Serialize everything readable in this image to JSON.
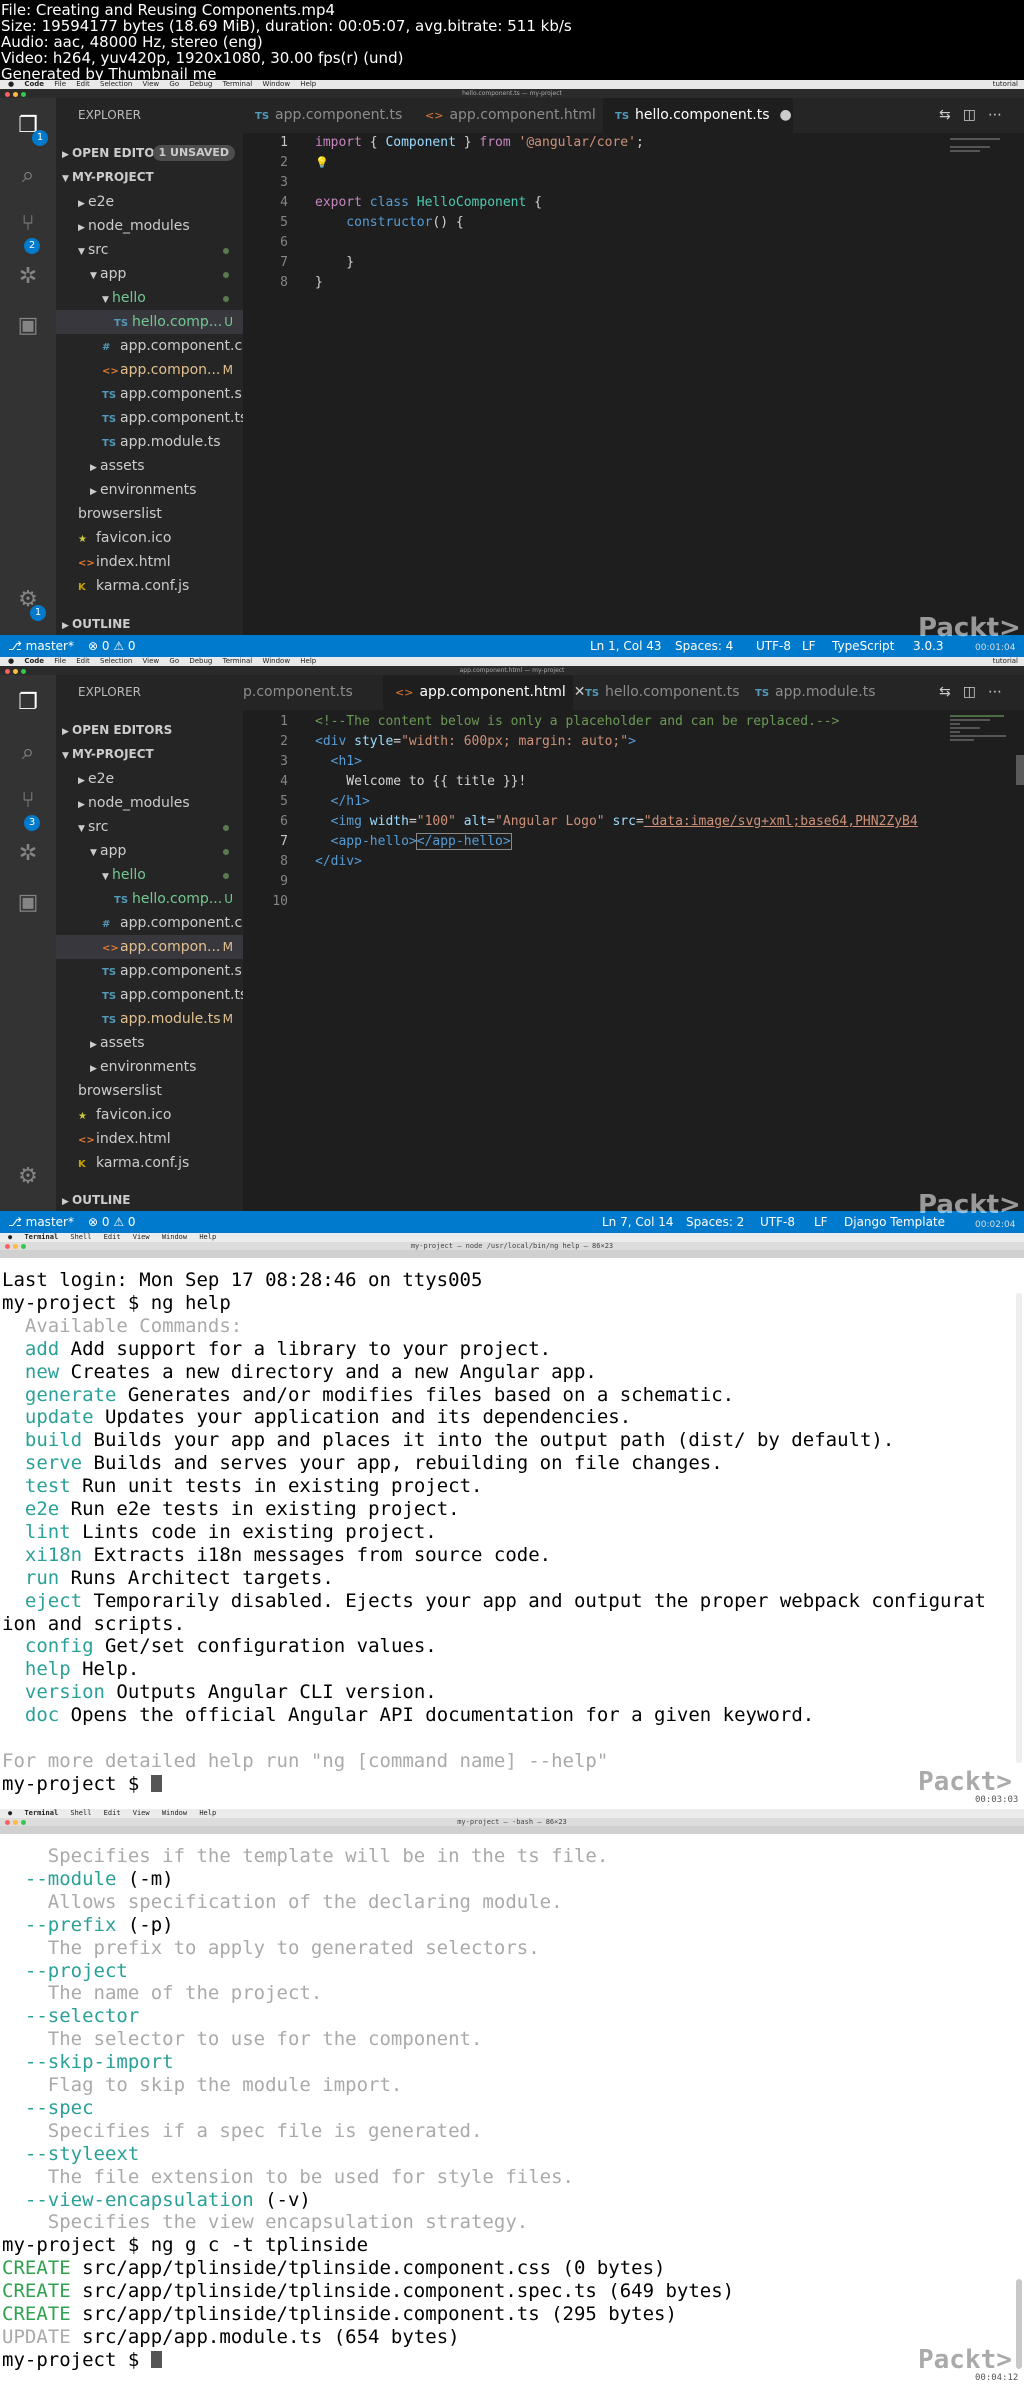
{
  "video_info": {
    "lines": [
      "File: Creating and Reusing Components.mp4",
      "Size: 19594177 bytes (18.69 MiB), duration: 00:05:07, avg.bitrate: 511 kb/s",
      "Audio: aac, 48000 Hz, stereo (eng)",
      "Video: h264, yuv420p, 1920x1080, 30.00 fps(r) (und)",
      "Generated by Thumbnail me"
    ]
  },
  "watermark": "Packt>",
  "frame1": {
    "menu": [
      "Code",
      "File",
      "Edit",
      "Selection",
      "View",
      "Go",
      "Debug",
      "Terminal",
      "Window",
      "Help"
    ],
    "menu_right": "tutorial",
    "window_title": "hello.component.ts — my-project",
    "explorer_title": "EXPLORER",
    "open_editors": "OPEN EDITORS",
    "unsaved": "1 UNSAVED",
    "project": "MY-PROJECT",
    "outline": "OUTLINE",
    "tree": [
      {
        "label": "e2e",
        "icon": "",
        "mark": ""
      },
      {
        "label": "node_modules",
        "icon": "",
        "mark": ""
      },
      {
        "label": "src",
        "icon": "",
        "mark": "dot"
      },
      {
        "label": "app",
        "icon": "",
        "mark": "dot"
      },
      {
        "label": "hello",
        "icon": "",
        "mark": "dot"
      },
      {
        "label": "hello.comp...",
        "icon": "TS",
        "mark": "U"
      },
      {
        "label": "app.component.css",
        "icon": "#",
        "mark": ""
      },
      {
        "label": "app.compon...",
        "icon": "<>",
        "mark": "M"
      },
      {
        "label": "app.component.s...",
        "icon": "TS",
        "mark": ""
      },
      {
        "label": "app.component.ts",
        "icon": "TS",
        "mark": ""
      },
      {
        "label": "app.module.ts",
        "icon": "TS",
        "mark": ""
      },
      {
        "label": "assets",
        "icon": "",
        "mark": ""
      },
      {
        "label": "environments",
        "icon": "",
        "mark": ""
      },
      {
        "label": "browserslist",
        "icon": "",
        "mark": ""
      },
      {
        "label": "favicon.ico",
        "icon": "★",
        "mark": ""
      },
      {
        "label": "index.html",
        "icon": "<>",
        "mark": ""
      },
      {
        "label": "karma.conf.js",
        "icon": "K",
        "mark": ""
      }
    ],
    "tabs": [
      "app.component.ts",
      "app.component.html",
      "hello.component.ts"
    ],
    "line_numbers": [
      "1",
      "2",
      "3",
      "4",
      "5",
      "6",
      "7",
      "8"
    ],
    "code": {
      "l1a": "import",
      "l1b": " { ",
      "l1c": "Component",
      "l1d": " } ",
      "l1e": "from",
      "l1f": " '@angular/core'",
      "l1g": ";",
      "l2": "💡",
      "l4a": "export",
      "l4b": " class ",
      "l4c": "HelloComponent",
      "l4d": " {",
      "l5a": "    constructor",
      "l5b": "() {",
      "l7": "    }",
      "l8": "}"
    },
    "status": {
      "branch": "⎇ master*",
      "problems": "⊗ 0 ⚠ 0",
      "position": "Ln 1, Col 43",
      "spaces": "Spaces: 4",
      "encoding": "UTF-8",
      "eol": "LF",
      "language": "TypeScript",
      "version": "3.0.3"
    },
    "timecode": "00:01:04"
  },
  "frame2": {
    "window_title": "app.component.html — my-project",
    "explorer_title": "EXPLORER",
    "open_editors": "OPEN EDITORS",
    "project": "MY-PROJECT",
    "outline": "OUTLINE",
    "tree": [
      {
        "label": "e2e",
        "icon": "",
        "mark": ""
      },
      {
        "label": "node_modules",
        "icon": "",
        "mark": ""
      },
      {
        "label": "src",
        "icon": "",
        "mark": "dot"
      },
      {
        "label": "app",
        "icon": "",
        "mark": "dot"
      },
      {
        "label": "hello",
        "icon": "",
        "mark": "dot"
      },
      {
        "label": "hello.comp...",
        "icon": "TS",
        "mark": "U"
      },
      {
        "label": "app.component.css",
        "icon": "#",
        "mark": ""
      },
      {
        "label": "app.compon...",
        "icon": "<>",
        "mark": "M"
      },
      {
        "label": "app.component.s...",
        "icon": "TS",
        "mark": ""
      },
      {
        "label": "app.component.ts",
        "icon": "TS",
        "mark": ""
      },
      {
        "label": "app.module.ts",
        "icon": "TS",
        "mark": "M"
      },
      {
        "label": "assets",
        "icon": "",
        "mark": ""
      },
      {
        "label": "environments",
        "icon": "",
        "mark": ""
      },
      {
        "label": "browserslist",
        "icon": "",
        "mark": ""
      },
      {
        "label": "favicon.ico",
        "icon": "★",
        "mark": ""
      },
      {
        "label": "index.html",
        "icon": "<>",
        "mark": ""
      },
      {
        "label": "karma.conf.js",
        "icon": "K",
        "mark": ""
      }
    ],
    "tabs": [
      "p.component.ts",
      "app.component.html",
      "hello.component.ts",
      "app.module.ts"
    ],
    "line_numbers": [
      "1",
      "2",
      "3",
      "4",
      "5",
      "6",
      "7",
      "8",
      "9",
      "10"
    ],
    "code": {
      "l1": "<!--The content below is only a placeholder and can be replaced.-->",
      "l2a": "<div ",
      "l2b": "style",
      "l2c": "=",
      "l2d": "\"width: 600px; margin: auto;\"",
      "l2e": ">",
      "l3": "  <h1>",
      "l4": "    Welcome to {{ title }}!",
      "l5": "  </h1>",
      "l6a": "  <img ",
      "l6b": "width",
      "l6c": "=",
      "l6d": "\"100\"",
      "l6e": " alt",
      "l6f": "=",
      "l6g": "\"Angular Logo\"",
      "l6h": " src",
      "l6i": "=",
      "l6j": "\"data:image/svg+xml;base64,PHN2ZyB4",
      "l7a": "  <app-hello>",
      "l7b": "</app-hello>",
      "l8": "</div>"
    },
    "status": {
      "branch": "⎇ master*",
      "problems": "⊗ 0 ⚠ 0",
      "position": "Ln 7, Col 14",
      "spaces": "Spaces: 2",
      "encoding": "UTF-8",
      "eol": "LF",
      "language": "Django Template"
    },
    "timecode": "00:02:04"
  },
  "frame3": {
    "menu": [
      "Terminal",
      "Shell",
      "Edit",
      "View",
      "Window",
      "Help"
    ],
    "title": "my-project — node /usr/local/bin/ng help — 86×23",
    "lines": [
      {
        "cmd": "",
        "text": "Last login: Mon Sep 17 08:28:46 on ttys005"
      },
      {
        "cmd": "",
        "text": "my-project $ ng help"
      },
      {
        "cmd": "",
        "text": "Available Commands:",
        "dim": true
      },
      {
        "cmd": "add",
        "text": " Add support for a library to your project."
      },
      {
        "cmd": "new",
        "text": " Creates a new directory and a new Angular app."
      },
      {
        "cmd": "generate",
        "text": " Generates and/or modifies files based on a schematic."
      },
      {
        "cmd": "update",
        "text": " Updates your application and its dependencies."
      },
      {
        "cmd": "build",
        "text": " Builds your app and places it into the output path (dist/ by default)."
      },
      {
        "cmd": "serve",
        "text": " Builds and serves your app, rebuilding on file changes."
      },
      {
        "cmd": "test",
        "text": " Run unit tests in existing project."
      },
      {
        "cmd": "e2e",
        "text": " Run e2e tests in existing project."
      },
      {
        "cmd": "lint",
        "text": " Lints code in existing project."
      },
      {
        "cmd": "xi18n",
        "text": " Extracts i18n messages from source code."
      },
      {
        "cmd": "run",
        "text": " Runs Architect targets."
      },
      {
        "cmd": "eject",
        "text": " Temporarily disabled. Ejects your app and output the proper webpack configurat"
      },
      {
        "cmd": "",
        "text": "ion and scripts.",
        "noindent": true
      },
      {
        "cmd": "config",
        "text": " Get/set configuration values."
      },
      {
        "cmd": "help",
        "text": " Help."
      },
      {
        "cmd": "version",
        "text": " Outputs Angular CLI version."
      },
      {
        "cmd": "doc",
        "text": " Opens the official Angular API documentation for a given keyword."
      },
      {
        "cmd": "",
        "text": ""
      },
      {
        "cmd": "",
        "text": "For more detailed help run \"ng [command name] --help\"",
        "dim": true
      },
      {
        "cmd": "",
        "text": "my-project $ ",
        "cursor": true
      }
    ],
    "timecode": "00:03:03"
  },
  "frame4": {
    "title": "my-project — -bash — 86×23",
    "lines": [
      {
        "kind": "dim",
        "text": "  Specifies if the template will be in the ts file."
      },
      {
        "kind": "opt",
        "opt": "--module",
        "text": " (-m)"
      },
      {
        "kind": "dim",
        "text": "  Allows specification of the declaring module."
      },
      {
        "kind": "opt",
        "opt": "--prefix",
        "text": " (-p)"
      },
      {
        "kind": "dim",
        "text": "  The prefix to apply to generated selectors."
      },
      {
        "kind": "opt",
        "opt": "--project",
        "text": ""
      },
      {
        "kind": "dim",
        "text": "  The name of the project."
      },
      {
        "kind": "opt",
        "opt": "--selector",
        "text": ""
      },
      {
        "kind": "dim",
        "text": "  The selector to use for the component."
      },
      {
        "kind": "opt",
        "opt": "--skip-import",
        "text": ""
      },
      {
        "kind": "dim",
        "text": "  Flag to skip the module import."
      },
      {
        "kind": "opt",
        "opt": "--spec",
        "text": ""
      },
      {
        "kind": "dim",
        "text": "  Specifies if a spec file is generated."
      },
      {
        "kind": "opt",
        "opt": "--styleext",
        "text": ""
      },
      {
        "kind": "dim",
        "text": "  The file extension to be used for style files."
      },
      {
        "kind": "opt",
        "opt": "--view-encapsulation",
        "text": " (-v)"
      },
      {
        "kind": "dim",
        "text": "  Specifies the view encapsulation strategy."
      },
      {
        "kind": "plain",
        "text": "my-project $ ng g c -t tplinside"
      },
      {
        "kind": "create",
        "verb": "CREATE",
        "text": " src/app/tplinside/tplinside.component.css (0 bytes)"
      },
      {
        "kind": "create",
        "verb": "CREATE",
        "text": " src/app/tplinside/tplinside.component.spec.ts (649 bytes)"
      },
      {
        "kind": "create",
        "verb": "CREATE",
        "text": " src/app/tplinside/tplinside.component.ts (295 bytes)"
      },
      {
        "kind": "update",
        "verb": "UPDATE",
        "text": " src/app/app.module.ts (654 bytes)"
      },
      {
        "kind": "prompt",
        "text": "my-project $ "
      }
    ],
    "timecode": "00:04:12"
  }
}
